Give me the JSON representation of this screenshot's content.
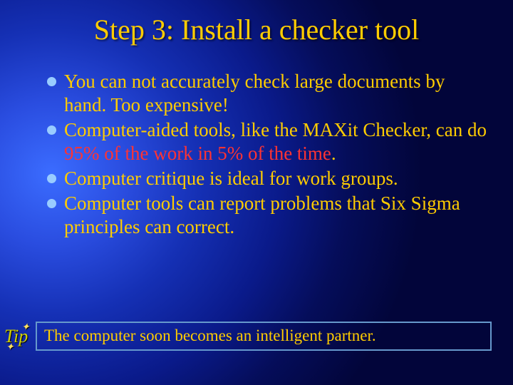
{
  "title": "Step 3:  Install a checker tool",
  "bullets": [
    {
      "pre": "You can not accurately check large documents by hand. Too expensive!"
    },
    {
      "pre": "Computer-aided tools, like the MAXit Checker, can do ",
      "emph": "95% of the work in 5% of the time",
      "post": "."
    },
    {
      "pre": "Computer critique is ideal for work groups."
    },
    {
      "pre": "Computer tools can report problems that Six Sigma principles can correct."
    }
  ],
  "tip": {
    "label": "Tip",
    "text": "The computer soon becomes an intelligent partner."
  }
}
